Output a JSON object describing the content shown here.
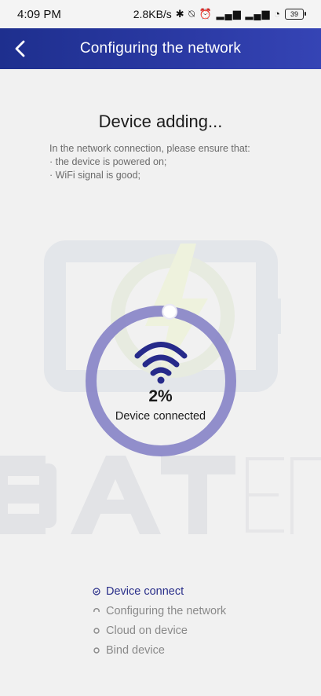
{
  "status_bar": {
    "time": "4:09 PM",
    "speed": "2.8KB/s",
    "icons_text": "✱ ⍉ ⏰ ▂▄▆ ▂▄▆ ◔",
    "battery": "39"
  },
  "header": {
    "title": "Configuring the network",
    "back_icon": "chevron-left-icon"
  },
  "main": {
    "title": "Device adding...",
    "instructions": [
      "In the network connection, please ensure that:",
      "· the device is powered on;",
      "· WiFi signal is good;"
    ],
    "progress_percent": "2%",
    "progress_value": 0.02,
    "status": "Device connected"
  },
  "watermark_text": "BATEN",
  "steps": [
    {
      "label": "Device connect",
      "state": "done"
    },
    {
      "label": "Configuring the network",
      "state": "pending"
    },
    {
      "label": "Cloud on device",
      "state": "pending"
    },
    {
      "label": "Bind device",
      "state": "pending"
    }
  ],
  "colors": {
    "header_bg": "#2a39a3",
    "ring": "#8a87c9",
    "wifi": "#262a8a",
    "active_step": "#2a2f8a"
  }
}
